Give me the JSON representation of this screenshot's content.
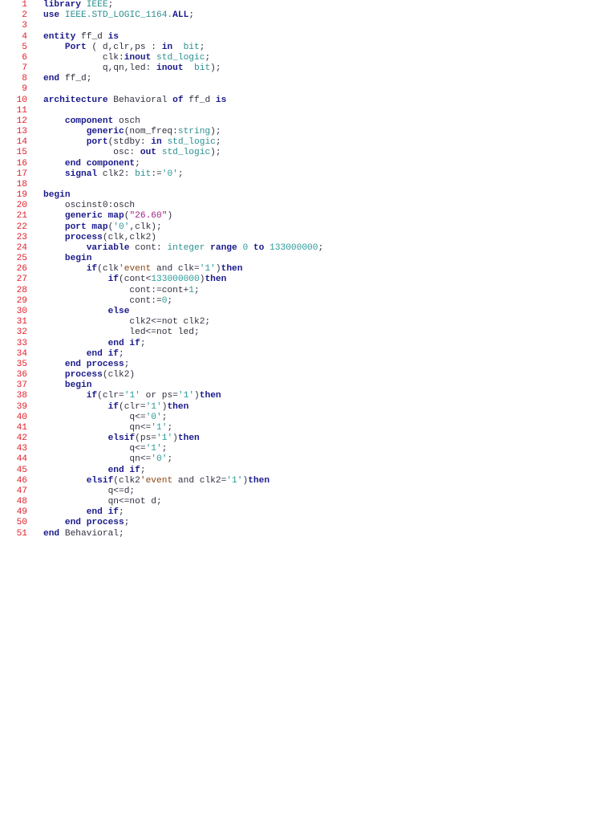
{
  "document": {
    "colors": {
      "line_number": "#e0202a",
      "keyword": "#1a1a8c",
      "type": "#2a9090",
      "string": "#a0208a",
      "attribute": "#8b4513"
    },
    "lines": [
      {
        "n": "1",
        "seg": [
          [
            "k",
            "library"
          ],
          [
            "p",
            " "
          ],
          [
            "t",
            "IEEE"
          ],
          [
            "p",
            ";"
          ]
        ]
      },
      {
        "n": "2",
        "seg": [
          [
            "k",
            "use"
          ],
          [
            "p",
            " "
          ],
          [
            "t",
            "IEEE.STD_LOGIC_1164."
          ],
          [
            "k",
            "ALL"
          ],
          [
            "p",
            ";"
          ]
        ]
      },
      {
        "n": "3",
        "seg": []
      },
      {
        "n": "4",
        "seg": [
          [
            "k",
            "entity"
          ],
          [
            "p",
            " ff_d "
          ],
          [
            "k",
            "is"
          ]
        ]
      },
      {
        "n": "5",
        "seg": [
          [
            "p",
            "    "
          ],
          [
            "k",
            "Port"
          ],
          [
            "p",
            " ( d,clr,ps : "
          ],
          [
            "k",
            "in"
          ],
          [
            "p",
            "  "
          ],
          [
            "t",
            "bit"
          ],
          [
            "p",
            ";"
          ]
        ]
      },
      {
        "n": "6",
        "seg": [
          [
            "p",
            "           clk:"
          ],
          [
            "k",
            "inout"
          ],
          [
            "p",
            " "
          ],
          [
            "t",
            "std_logic"
          ],
          [
            "p",
            ";"
          ]
        ]
      },
      {
        "n": "7",
        "seg": [
          [
            "p",
            "           q,qn,led: "
          ],
          [
            "k",
            "inout"
          ],
          [
            "p",
            "  "
          ],
          [
            "t",
            "bit"
          ],
          [
            "p",
            ");"
          ]
        ]
      },
      {
        "n": "8",
        "seg": [
          [
            "k",
            "end"
          ],
          [
            "p",
            " ff_d;"
          ]
        ]
      },
      {
        "n": "9",
        "seg": []
      },
      {
        "n": "10",
        "seg": [
          [
            "k",
            "architecture"
          ],
          [
            "p",
            " Behavioral "
          ],
          [
            "k",
            "of"
          ],
          [
            "p",
            " ff_d "
          ],
          [
            "k",
            "is"
          ]
        ]
      },
      {
        "n": "11",
        "seg": []
      },
      {
        "n": "12",
        "seg": [
          [
            "p",
            "    "
          ],
          [
            "k",
            "component"
          ],
          [
            "p",
            " osch"
          ]
        ]
      },
      {
        "n": "13",
        "seg": [
          [
            "p",
            "        "
          ],
          [
            "k",
            "generic"
          ],
          [
            "p",
            "(nom_freq:"
          ],
          [
            "t",
            "string"
          ],
          [
            "p",
            ");"
          ]
        ]
      },
      {
        "n": "14",
        "seg": [
          [
            "p",
            "        "
          ],
          [
            "k",
            "port"
          ],
          [
            "p",
            "(stdby: "
          ],
          [
            "k",
            "in"
          ],
          [
            "p",
            " "
          ],
          [
            "t",
            "std_logic"
          ],
          [
            "p",
            ";"
          ]
        ]
      },
      {
        "n": "15",
        "seg": [
          [
            "p",
            "             osc: "
          ],
          [
            "k",
            "out"
          ],
          [
            "p",
            " "
          ],
          [
            "t",
            "std_logic"
          ],
          [
            "p",
            ");"
          ]
        ]
      },
      {
        "n": "16",
        "seg": [
          [
            "p",
            "    "
          ],
          [
            "k",
            "end component"
          ],
          [
            "p",
            ";"
          ]
        ]
      },
      {
        "n": "17",
        "seg": [
          [
            "p",
            "    "
          ],
          [
            "k",
            "signal"
          ],
          [
            "p",
            " clk2: "
          ],
          [
            "t",
            "bit"
          ],
          [
            "p",
            ":="
          ],
          [
            "n",
            "'0'"
          ],
          [
            "p",
            ";"
          ]
        ]
      },
      {
        "n": "18",
        "seg": []
      },
      {
        "n": "19",
        "seg": [
          [
            "k",
            "begin"
          ]
        ]
      },
      {
        "n": "20",
        "seg": [
          [
            "p",
            "    oscinst0:osch"
          ]
        ]
      },
      {
        "n": "21",
        "seg": [
          [
            "p",
            "    "
          ],
          [
            "k",
            "generic map"
          ],
          [
            "p",
            "("
          ],
          [
            "s",
            "\"26.60\""
          ],
          [
            "p",
            ")"
          ]
        ]
      },
      {
        "n": "22",
        "seg": [
          [
            "p",
            "    "
          ],
          [
            "k",
            "port map"
          ],
          [
            "p",
            "("
          ],
          [
            "n",
            "'0'"
          ],
          [
            "p",
            ",clk);"
          ]
        ]
      },
      {
        "n": "23",
        "seg": [
          [
            "p",
            "    "
          ],
          [
            "k",
            "process"
          ],
          [
            "p",
            "(clk,clk2)"
          ]
        ]
      },
      {
        "n": "24",
        "seg": [
          [
            "p",
            "        "
          ],
          [
            "k",
            "variable"
          ],
          [
            "p",
            " cont: "
          ],
          [
            "t",
            "integer"
          ],
          [
            "p",
            " "
          ],
          [
            "k",
            "range"
          ],
          [
            "p",
            " "
          ],
          [
            "n",
            "0"
          ],
          [
            "p",
            " "
          ],
          [
            "k",
            "to"
          ],
          [
            "p",
            " "
          ],
          [
            "n",
            "133000000"
          ],
          [
            "p",
            ";"
          ]
        ]
      },
      {
        "n": "25",
        "seg": [
          [
            "p",
            "    "
          ],
          [
            "k",
            "begin"
          ]
        ]
      },
      {
        "n": "26",
        "seg": [
          [
            "p",
            "        "
          ],
          [
            "k",
            "if"
          ],
          [
            "p",
            "(clk"
          ],
          [
            "a",
            "'event"
          ],
          [
            "p",
            " and clk="
          ],
          [
            "n",
            "'1'"
          ],
          [
            "p",
            ")"
          ],
          [
            "k",
            "then"
          ]
        ]
      },
      {
        "n": "27",
        "seg": [
          [
            "p",
            "            "
          ],
          [
            "k",
            "if"
          ],
          [
            "p",
            "(cont<"
          ],
          [
            "n",
            "133000000"
          ],
          [
            "p",
            ")"
          ],
          [
            "k",
            "then"
          ]
        ]
      },
      {
        "n": "28",
        "seg": [
          [
            "p",
            "                cont:=cont+"
          ],
          [
            "n",
            "1"
          ],
          [
            "p",
            ";"
          ]
        ]
      },
      {
        "n": "29",
        "seg": [
          [
            "p",
            "                cont:="
          ],
          [
            "n",
            "0"
          ],
          [
            "p",
            ";"
          ]
        ]
      },
      {
        "n": "30",
        "seg": [
          [
            "p",
            "            "
          ],
          [
            "k",
            "else"
          ]
        ]
      },
      {
        "n": "31",
        "seg": [
          [
            "p",
            "                clk2<=not clk2;"
          ]
        ]
      },
      {
        "n": "32",
        "seg": [
          [
            "p",
            "                led<=not led;"
          ]
        ]
      },
      {
        "n": "33",
        "seg": [
          [
            "p",
            "            "
          ],
          [
            "k",
            "end if"
          ],
          [
            "p",
            ";"
          ]
        ]
      },
      {
        "n": "34",
        "seg": [
          [
            "p",
            "        "
          ],
          [
            "k",
            "end if"
          ],
          [
            "p",
            ";"
          ]
        ]
      },
      {
        "n": "35",
        "seg": [
          [
            "p",
            "    "
          ],
          [
            "k",
            "end process"
          ],
          [
            "p",
            ";"
          ]
        ]
      },
      {
        "n": "36",
        "seg": [
          [
            "p",
            "    "
          ],
          [
            "k",
            "process"
          ],
          [
            "p",
            "(clk2)"
          ]
        ]
      },
      {
        "n": "37",
        "seg": [
          [
            "p",
            "    "
          ],
          [
            "k",
            "begin"
          ]
        ]
      },
      {
        "n": "38",
        "seg": [
          [
            "p",
            "        "
          ],
          [
            "k",
            "if"
          ],
          [
            "p",
            "(clr="
          ],
          [
            "n",
            "'1'"
          ],
          [
            "p",
            " or ps="
          ],
          [
            "n",
            "'1'"
          ],
          [
            "p",
            ")"
          ],
          [
            "k",
            "then"
          ]
        ]
      },
      {
        "n": "39",
        "seg": [
          [
            "p",
            "            "
          ],
          [
            "k",
            "if"
          ],
          [
            "p",
            "(clr="
          ],
          [
            "n",
            "'1'"
          ],
          [
            "p",
            ")"
          ],
          [
            "k",
            "then"
          ]
        ]
      },
      {
        "n": "40",
        "seg": [
          [
            "p",
            "                q<="
          ],
          [
            "n",
            "'0'"
          ],
          [
            "p",
            ";"
          ]
        ]
      },
      {
        "n": "41",
        "seg": [
          [
            "p",
            "                qn<="
          ],
          [
            "n",
            "'1'"
          ],
          [
            "p",
            ";"
          ]
        ]
      },
      {
        "n": "42",
        "seg": [
          [
            "p",
            "            "
          ],
          [
            "k",
            "elsif"
          ],
          [
            "p",
            "(ps="
          ],
          [
            "n",
            "'1'"
          ],
          [
            "p",
            ")"
          ],
          [
            "k",
            "then"
          ]
        ]
      },
      {
        "n": "43",
        "seg": [
          [
            "p",
            "                q<="
          ],
          [
            "n",
            "'1'"
          ],
          [
            "p",
            ";"
          ]
        ]
      },
      {
        "n": "44",
        "seg": [
          [
            "p",
            "                qn<="
          ],
          [
            "n",
            "'0'"
          ],
          [
            "p",
            ";"
          ]
        ]
      },
      {
        "n": "45",
        "seg": [
          [
            "p",
            "            "
          ],
          [
            "k",
            "end if"
          ],
          [
            "p",
            ";"
          ]
        ]
      },
      {
        "n": "46",
        "seg": [
          [
            "p",
            "        "
          ],
          [
            "k",
            "elsif"
          ],
          [
            "p",
            "(clk2"
          ],
          [
            "a",
            "'event"
          ],
          [
            "p",
            " and clk2="
          ],
          [
            "n",
            "'1'"
          ],
          [
            "p",
            ")"
          ],
          [
            "k",
            "then"
          ]
        ]
      },
      {
        "n": "47",
        "seg": [
          [
            "p",
            "            q<=d;"
          ]
        ]
      },
      {
        "n": "48",
        "seg": [
          [
            "p",
            "            qn<=not d;"
          ]
        ]
      },
      {
        "n": "49",
        "seg": [
          [
            "p",
            "        "
          ],
          [
            "k",
            "end if"
          ],
          [
            "p",
            ";"
          ]
        ]
      },
      {
        "n": "50",
        "seg": [
          [
            "p",
            "    "
          ],
          [
            "k",
            "end process"
          ],
          [
            "p",
            ";"
          ]
        ]
      },
      {
        "n": "51",
        "seg": [
          [
            "k",
            "end"
          ],
          [
            "p",
            " Behavioral;"
          ]
        ]
      }
    ]
  }
}
